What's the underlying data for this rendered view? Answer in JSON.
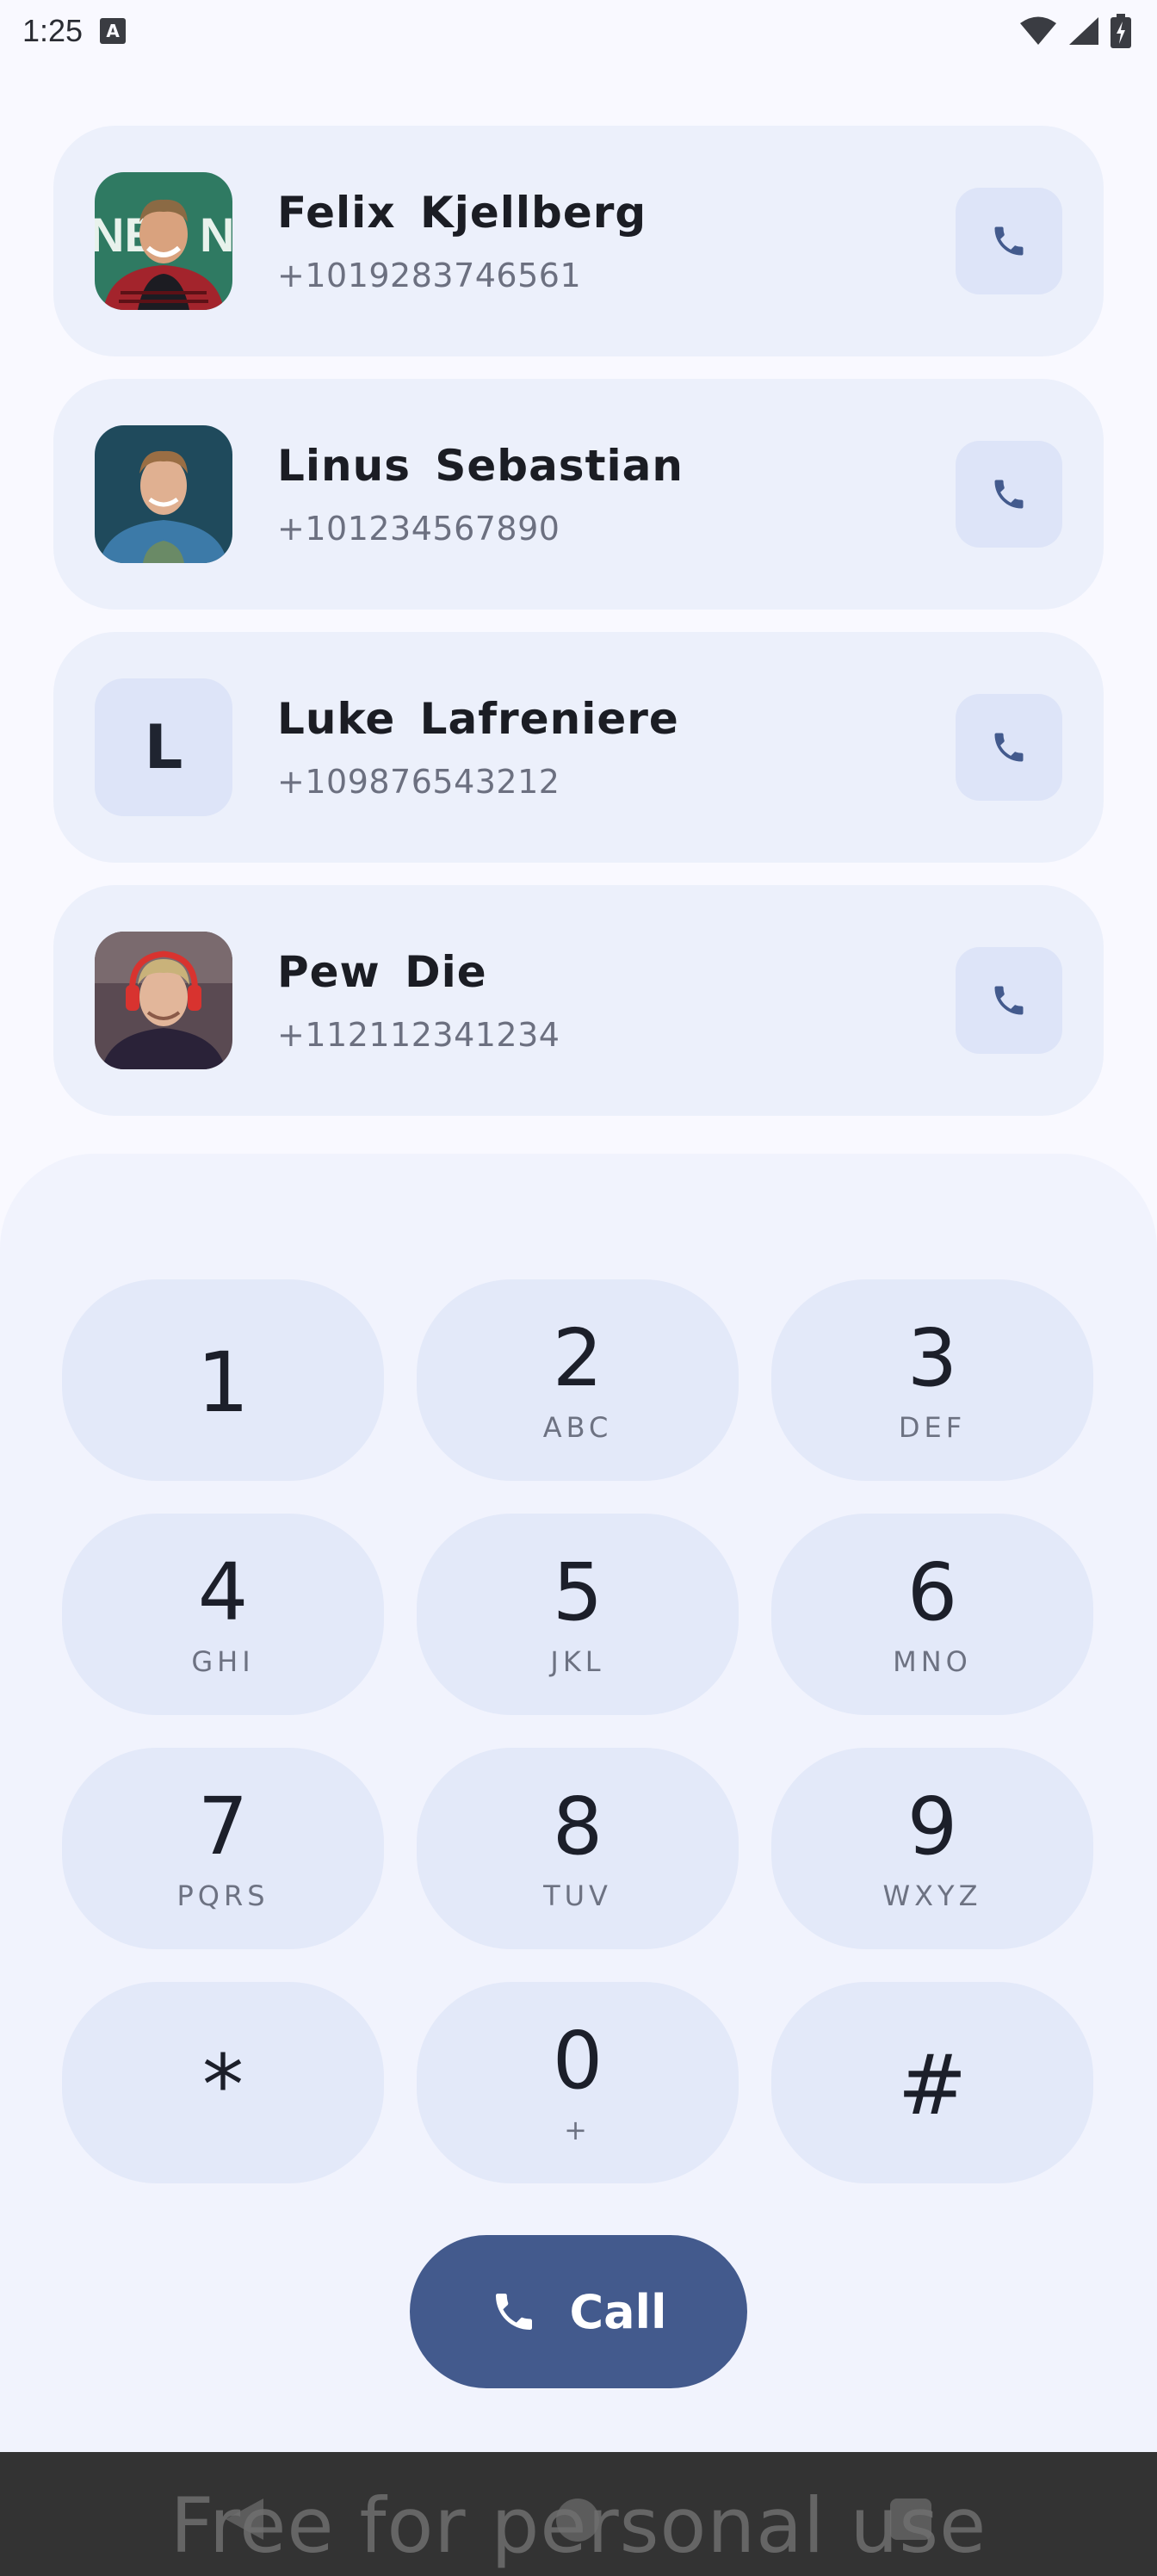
{
  "status_bar": {
    "time": "1:25",
    "notification_icon_letter": "A",
    "icons": [
      "wifi-icon",
      "signal-icon",
      "battery-charging-icon"
    ]
  },
  "contacts": [
    {
      "name": "Felix  Kjellberg",
      "phone": "+1019283746561",
      "avatar": "photo",
      "avatar_letter": ""
    },
    {
      "name": "Linus  Sebastian",
      "phone": "+101234567890",
      "avatar": "photo",
      "avatar_letter": ""
    },
    {
      "name": "Luke  Lafreniere",
      "phone": "+109876543212",
      "avatar": "letter",
      "avatar_letter": "L"
    },
    {
      "name": "Pew Die",
      "phone": "+112112341234",
      "avatar": "photo",
      "avatar_letter": ""
    }
  ],
  "keypad": {
    "keys": [
      {
        "digit": "1",
        "letters": ""
      },
      {
        "digit": "2",
        "letters": "ABC"
      },
      {
        "digit": "3",
        "letters": "DEF"
      },
      {
        "digit": "4",
        "letters": "GHI"
      },
      {
        "digit": "5",
        "letters": "JKL"
      },
      {
        "digit": "6",
        "letters": "MNO"
      },
      {
        "digit": "7",
        "letters": "PQRS"
      },
      {
        "digit": "8",
        "letters": "TUV"
      },
      {
        "digit": "9",
        "letters": "WXYZ"
      },
      {
        "digit": "*",
        "letters": ""
      },
      {
        "digit": "0",
        "letters": "+"
      },
      {
        "digit": "#",
        "letters": ""
      }
    ]
  },
  "call_button": {
    "label": "Call"
  },
  "watermark": "Free for personal use",
  "colors": {
    "accent": "#435a8d",
    "card_background": "#ecf0fb",
    "key_background": "#e3e9f9",
    "phone_icon": "#435a8d"
  }
}
